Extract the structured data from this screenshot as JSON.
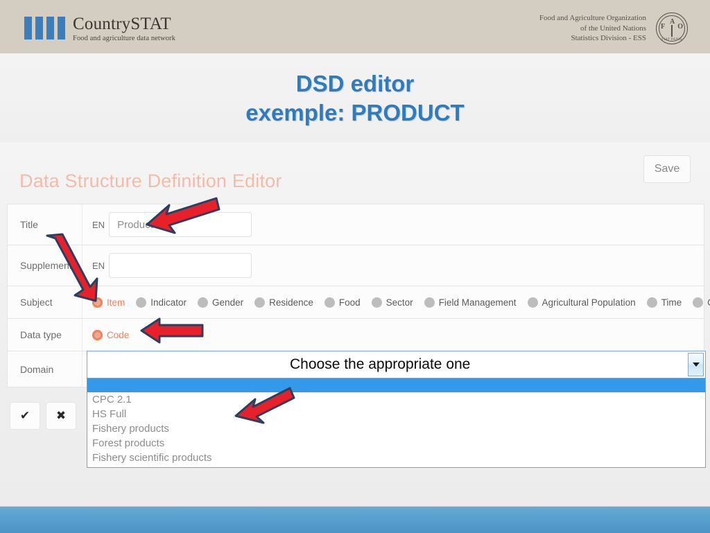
{
  "header": {
    "brand_name": "CountrySTAT",
    "brand_tagline": "Food and agriculture data network",
    "org_line1": "Food and Agriculture Organization",
    "org_line2": "of the United Nations",
    "org_line3": "Statistics Division - ESS",
    "fao_letter_f": "F",
    "fao_letter_a": "A",
    "fao_letter_o": "O",
    "fao_motto": "FIAT PANIS",
    "band_color": "#d3cdc2"
  },
  "slide": {
    "title_line1": "DSD editor",
    "title_line2": "exemple: PRODUCT",
    "title_color": "#2e7cc0"
  },
  "app": {
    "heading": "Data Structure Definition Editor",
    "heading_color": "#f3bba8",
    "save_label": "Save",
    "confirm_label": "✔",
    "cancel_label": "✖"
  },
  "form": {
    "rows": [
      {
        "label": "Title",
        "lang": "EN",
        "value": "Product"
      },
      {
        "label": "Supplement",
        "lang": "EN",
        "value": ""
      },
      {
        "label": "Subject"
      },
      {
        "label": "Data type"
      },
      {
        "label": "Domain"
      }
    ],
    "subject_options": [
      {
        "label": "Item",
        "selected": true
      },
      {
        "label": "Indicator",
        "selected": false
      },
      {
        "label": "Gender",
        "selected": false
      },
      {
        "label": "Residence",
        "selected": false
      },
      {
        "label": "Food",
        "selected": false
      },
      {
        "label": "Sector",
        "selected": false
      },
      {
        "label": "Field Management",
        "selected": false
      },
      {
        "label": "Agricultural Population",
        "selected": false
      },
      {
        "label": "Time",
        "selected": false
      },
      {
        "label": "Geo",
        "selected": false
      }
    ],
    "datatype_options": [
      {
        "label": "Code",
        "selected": true
      }
    ],
    "selected_accent": "#f4825c"
  },
  "domain_dropdown": {
    "value": "",
    "open": true,
    "highlight_color": "#3399e8",
    "options": [
      "",
      "CPC 2.1",
      "HS Full",
      "Fishery products",
      "Forest products",
      "Fishery scientific products"
    ]
  },
  "annotations": {
    "choose_text": "Choose the appropriate one",
    "arrow_color": "#e8202a",
    "arrow_outline": "#2a3f62"
  }
}
